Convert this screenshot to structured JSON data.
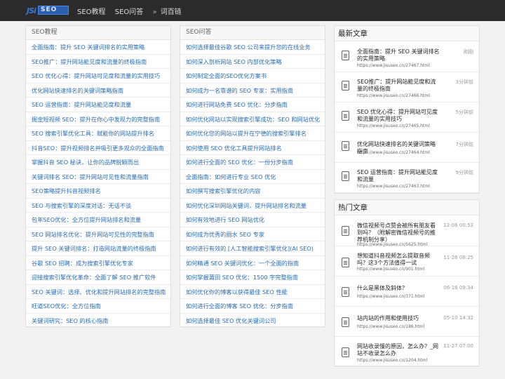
{
  "header": {
    "logo_mark": "JSi",
    "logo_text": "SEO",
    "nav": [
      "SEO教程",
      "SEO问答",
      "词百链"
    ],
    "nav_sep": "»"
  },
  "left_column": {
    "title": "SEO教程",
    "items": [
      "全面指南：提升 SEO 关键词排名的实用策略",
      "SEO推广：提升网站能见度和流量的终极指南",
      "SEO 优化心得：提升网站可见度和流量的实用技巧",
      "优化网站快速排名的关键词策略指南",
      "SEO 运营指南：提升网站能见度和流量",
      "掘金短视频 SEO：提升在你心中发现力的完整指南",
      "SEO 搜索引擎优化工具：赋能你的网站提升排名",
      "抖音SEO：提升视频排名并吸引更多观众的全面指南",
      "掌握抖音 SEO 秘诀，让你的品牌脱颖而出",
      "关键词排名 SEO：提升网站可见性和流量指南",
      "SEO策略提升抖音视频排名",
      "SEO 与搜索引擎的深度对话：无话不谈",
      "包年SEO优化：全方位提升网站排名和流量",
      "SEO 网站排名优化：提升网站可见性的完整指南",
      "提升 SEO 关键词排名：打造网站流量的终极指南",
      "谷歌 SEO 招聘：成为搜索引擎优化专家",
      "迎接搜索引擎优化革命：全面了解 SEO 推广软件",
      "SEO 关键词：选择、优化和提升网站排名的完整指南",
      "旺道SEO优化：全方位指南",
      "关键词研究：SEO 的核心指南"
    ]
  },
  "mid_column": {
    "title": "SEO问答",
    "items": [
      "如何选择最佳谷歌 SEO 公司来提升您的在线业务",
      "如何深入剖析网站 SEO 内部优化策略",
      "如何制定全面的SEO优化方案书",
      "如何成为一名靠谱的 SEO 专家：实用指南",
      "如何进行网站免费 SEO 优化：分步指南",
      "如何优化网站以实现搜索引擎成功：SEO 和网站优化",
      "如何优化您的网站以提升在宁德的搜索引擎排名",
      "如何使用 SEO 优化工具提升网站排名",
      "如何进行全面的 SEO 优化：一份分步指南",
      "全面指南：如何进行专业 SEO 优化",
      "如何撰写搜索引擎优化的内容",
      "如何优化深圳网站关键词，提升网站排名和流量",
      "如何有效地进行 SEO 网站优化",
      "如何成为优秀的丽水 SEO 专家",
      "如何进行有效的 [人工智能搜索引擎优化](AI SEO)",
      "如何精通 SEO 关键词优化：一个全面的指南",
      "如何掌握莆田 SEO 优化：1500 字完整指南",
      "如何优化你的博客以获得最佳 SEO 性能",
      "如何进行全面的博客 SEO 优化：分步指南",
      "如何选择最佳 SEO 优化关键词公司"
    ]
  },
  "latest": {
    "title": "最新文章",
    "items": [
      {
        "title": "全面指南：提升 SEO 关键词排名的实用策略",
        "url": "https://www.jisuseo.cn/27467.html",
        "time": "刚刚"
      },
      {
        "title": "SEO推广：提升网站能见度和流量的终极指南",
        "url": "https://www.jisuseo.cn/27466.html",
        "time": "3分钟前"
      },
      {
        "title": "SEO 优化心得：提升网站可见度和流量的实用技巧",
        "url": "https://www.jisuseo.cn/27465.html",
        "time": "5分钟前"
      },
      {
        "title": "优化网站快速排名的关键词策略指南",
        "url": "https://www.jisuseo.cn/27464.html",
        "time": "7分钟前"
      },
      {
        "title": "SEO 运营指南：提升网站能见度和流量",
        "url": "https://www.jisuseo.cn/27463.html",
        "time": "9分钟前"
      }
    ]
  },
  "hot": {
    "title": "热门文章",
    "items": [
      {
        "title": "微信视频号点赞会被所有朋友看到吗？（附解密微信视频号的推荐机制分享）",
        "url": "https://www.jisuseo.cn/5625.html",
        "time": "12-06 00:53"
      },
      {
        "title": "想知道抖音视频怎么提取音频吗？这3个方法值得一试",
        "url": "https://www.jisuseo.cn/901.html",
        "time": "11-26 08:25"
      },
      {
        "title": "什么是黑体及斜体？",
        "url": "https://www.jisuseo.cn/371.html",
        "time": "06-16 09:34"
      },
      {
        "title": "站内站的作用和使用技巧",
        "url": "https://www.jisuseo.cn/186.html",
        "time": "05-10 14:32"
      },
      {
        "title": "网站收录慢的原因，怎么办？_网站不收录怎么办",
        "url": "https://www.jisuseo.cn/1204.html",
        "time": "11-27 07:00"
      }
    ]
  }
}
